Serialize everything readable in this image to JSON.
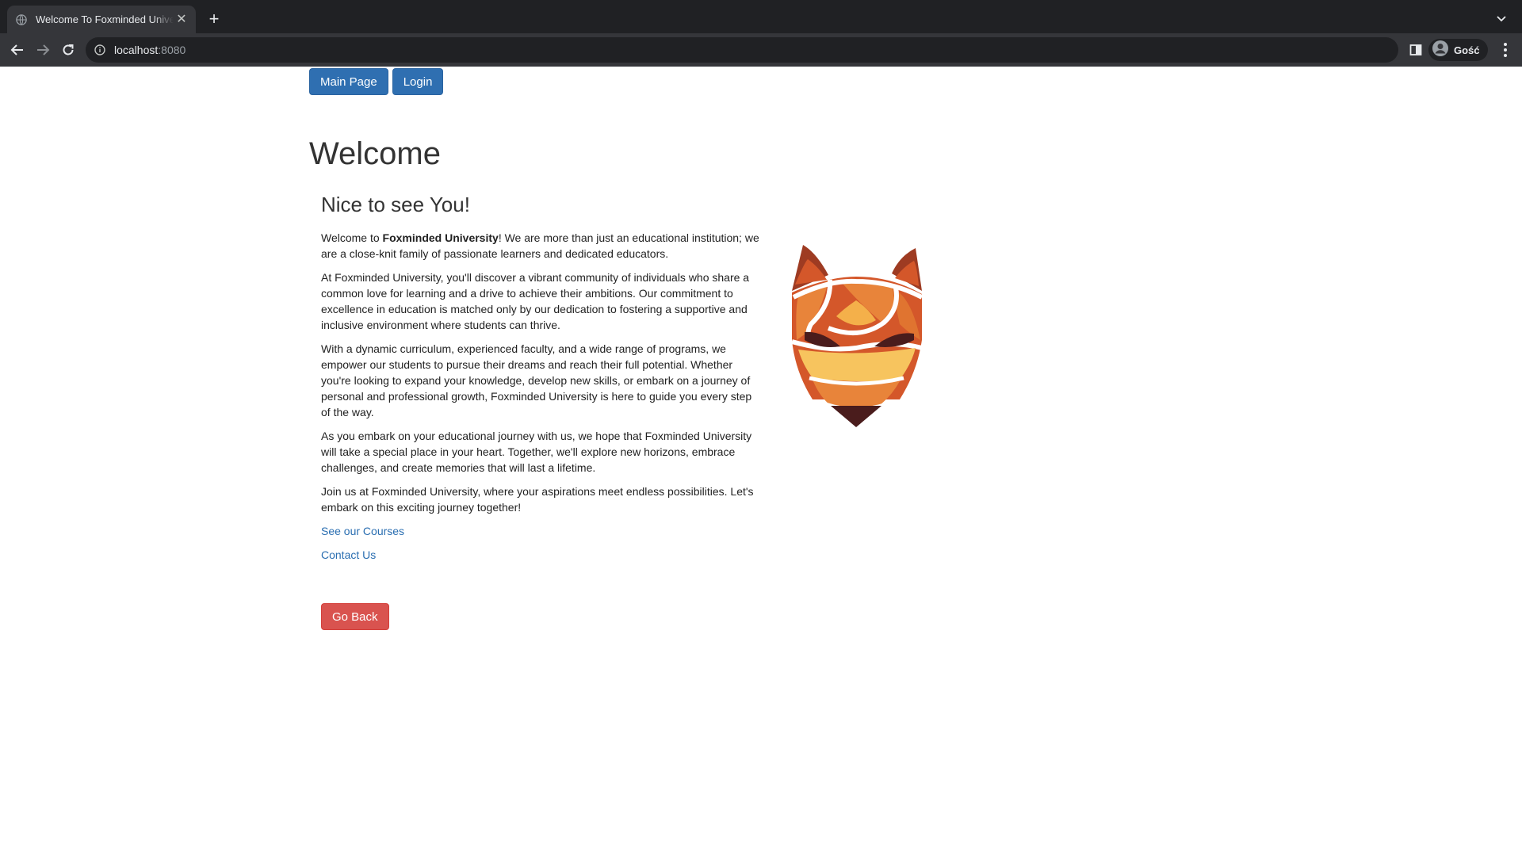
{
  "browser": {
    "tab_title": "Welcome To Foxminded University",
    "url_host": "localhost",
    "url_port": ":8080",
    "profile_label": "Gość"
  },
  "nav": {
    "main_page": "Main Page",
    "login": "Login"
  },
  "page": {
    "heading": "Welcome",
    "subheading": "Nice to see You!",
    "intro_prefix": "Welcome to ",
    "intro_bold": "Foxminded University",
    "intro_suffix": "! We are more than just an educational institution; we are a close-knit family of passionate learners and dedicated educators.",
    "paragraphs": [
      "At Foxminded University, you'll discover a vibrant community of individuals who share a common love for learning and a drive to achieve their ambitions. Our commitment to excellence in education is matched only by our dedication to fostering a supportive and inclusive environment where students can thrive.",
      "With a dynamic curriculum, experienced faculty, and a wide range of programs, we empower our students to pursue their dreams and reach their full potential. Whether you're looking to expand your knowledge, develop new skills, or embark on a journey of personal and professional growth, Foxminded University is here to guide you every step of the way.",
      "As you embark on your educational journey with us, we hope that Foxminded University will take a special place in your heart. Together, we'll explore new horizons, embrace challenges, and create memories that will last a lifetime.",
      "Join us at Foxminded University, where your aspirations meet endless possibilities. Let's embark on this exciting journey together!"
    ],
    "link_courses": "See our Courses",
    "link_contact": "Contact Us",
    "go_back": "Go Back"
  },
  "colors": {
    "primary": "#2f6fb1",
    "danger": "#d9534f",
    "link": "#2a6eb1"
  },
  "icons": {
    "tab_favicon": "globe-icon",
    "tab_close": "close-icon",
    "new_tab": "plus-icon",
    "back": "arrow-left-icon",
    "forward": "arrow-right-icon",
    "reload": "reload-icon",
    "site_info": "info-icon",
    "side_panel": "side-panel-icon",
    "profile": "avatar-icon",
    "menu": "kebab-menu-icon",
    "logo": "fox-logo"
  }
}
